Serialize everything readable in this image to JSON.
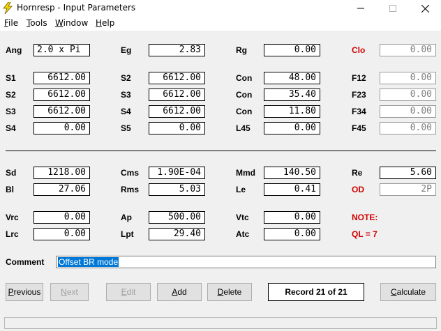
{
  "window": {
    "title": "Hornresp - Input Parameters"
  },
  "menu": [
    {
      "first": "F",
      "rest": "ile"
    },
    {
      "first": "T",
      "rest": "ools"
    },
    {
      "first": "W",
      "rest": "indow"
    },
    {
      "first": "H",
      "rest": "elp"
    }
  ],
  "labels": {
    "ang": "Ang",
    "eg": "Eg",
    "rg": "Rg",
    "clo": "Clo",
    "s1": "S1",
    "s2a": "S2",
    "con1": "Con",
    "f12": "F12",
    "s2b": "S2",
    "s3a": "S3",
    "con2": "Con",
    "f23": "F23",
    "s3b": "S3",
    "s4a": "S4",
    "con3": "Con",
    "f34": "F34",
    "s4b": "S4",
    "s5": "S5",
    "l45": "L45",
    "f45": "F45",
    "sd": "Sd",
    "cms": "Cms",
    "mmd": "Mmd",
    "re": "Re",
    "bl": "Bl",
    "rms": "Rms",
    "le": "Le",
    "od": "OD",
    "vrc": "Vrc",
    "ap": "Ap",
    "vtc": "Vtc",
    "note": "NOTE:",
    "lrc": "Lrc",
    "lpt": "Lpt",
    "atc": "Atc",
    "ql": "QL = 7",
    "comment": "Comment"
  },
  "values": {
    "ang": "2.0 x Pi",
    "eg": "2.83",
    "rg": "0.00",
    "clo": "0.00",
    "s1": "6612.00",
    "s2a": "6612.00",
    "con1": "48.00",
    "f12": "0.00",
    "s2b": "6612.00",
    "s3a": "6612.00",
    "con2": "35.40",
    "f23": "0.00",
    "s3b": "6612.00",
    "s4a": "6612.00",
    "con3": "11.80",
    "f34": "0.00",
    "s4b": "0.00",
    "s5": "0.00",
    "l45": "0.00",
    "f45": "0.00",
    "sd": "1218.00",
    "cms": "1.90E-04",
    "mmd": "140.50",
    "re": "5.60",
    "bl": "27.06",
    "rms": "5.03",
    "le": "0.41",
    "od": "2P",
    "vrc": "0.00",
    "ap": "500.00",
    "vtc": "0.00",
    "lrc": "0.00",
    "lpt": "29.40",
    "atc": "0.00"
  },
  "comment": {
    "value": "Offset BR mode"
  },
  "buttons": {
    "previous": {
      "first": "P",
      "rest": "revious"
    },
    "next": {
      "first": "N",
      "rest": "ext"
    },
    "edit": {
      "first": "E",
      "rest": "dit"
    },
    "add": {
      "first": "A",
      "rest": "dd"
    },
    "delete": {
      "first": "D",
      "rest": "elete"
    },
    "calculate": {
      "first": "C",
      "rest": "alculate"
    }
  },
  "record": {
    "label": "Record 21 of 21"
  },
  "colors": {
    "warning_red": "#d00000",
    "selection_blue": "#0078d7"
  }
}
